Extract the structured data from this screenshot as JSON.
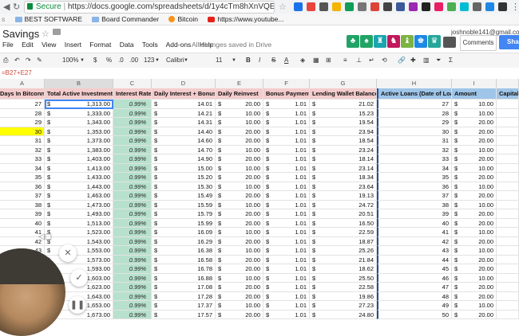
{
  "browser": {
    "secure_label": "Secure",
    "url": "https://docs.google.com/spreadsheets/d/1y4cTm8hXnVQEIO9X..."
  },
  "bookmarks": [
    "BEST SOFTWARE",
    "Board Commander",
    "Bitcoin",
    "https://www.youtube..."
  ],
  "doc": {
    "title": "Savings",
    "menus": [
      "File",
      "Edit",
      "View",
      "Insert",
      "Format",
      "Data",
      "Tools",
      "Add-ons",
      "Help"
    ],
    "save_status": "All changes saved in Drive",
    "user_email": "joshnoble141@gmail.co",
    "comments_label": "Comments",
    "share_label": "Sha"
  },
  "toolbar": {
    "zoom": "100%",
    "currency": "$",
    "percent": "%",
    "decimals_dec": ".0",
    "decimals_inc": ".00",
    "format_more": "123",
    "font": "Calibri",
    "font_size": "11",
    "bold": "B",
    "italic": "I",
    "strike": "S",
    "text_color": "A"
  },
  "formula": "=B27+E27",
  "columns": [
    "A",
    "B",
    "C",
    "D",
    "E",
    "F",
    "G",
    "H",
    "I"
  ],
  "headers": [
    "Days In Bitconnect",
    "Total Active Investment",
    "Interest Rate",
    "Daily Interest + Bonus",
    "Daily Reinvest",
    "Bonus Payment",
    "Lending Wallet Balance",
    "Active Loans (Date of Loan",
    "Amount",
    "Capital R"
  ],
  "rows": [
    {
      "day": "27",
      "investment": "1,313.00",
      "rate": "0.99%",
      "interest": "14.01",
      "reinvest": "20.00",
      "bonus": "1.01",
      "balance": "21.02",
      "loan": "27",
      "amount": "10.00"
    },
    {
      "day": "28",
      "investment": "1,333.00",
      "rate": "0.99%",
      "interest": "14.21",
      "reinvest": "10.00",
      "bonus": "1.01",
      "balance": "15.23",
      "loan": "28",
      "amount": "10.00"
    },
    {
      "day": "29",
      "investment": "1,343.00",
      "rate": "0.99%",
      "interest": "14.31",
      "reinvest": "10.00",
      "bonus": "1.01",
      "balance": "19.54",
      "loan": "29",
      "amount": "20.00"
    },
    {
      "day": "30",
      "investment": "1,353.00",
      "rate": "0.99%",
      "interest": "14.40",
      "reinvest": "20.00",
      "bonus": "1.01",
      "balance": "23.94",
      "loan": "30",
      "amount": "20.00"
    },
    {
      "day": "31",
      "investment": "1,373.00",
      "rate": "0.99%",
      "interest": "14.60",
      "reinvest": "20.00",
      "bonus": "1.01",
      "balance": "18.54",
      "loan": "31",
      "amount": "20.00"
    },
    {
      "day": "32",
      "investment": "1,383.00",
      "rate": "0.99%",
      "interest": "14.70",
      "reinvest": "10.00",
      "bonus": "1.01",
      "balance": "23.24",
      "loan": "32",
      "amount": "10.00"
    },
    {
      "day": "33",
      "investment": "1,403.00",
      "rate": "0.99%",
      "interest": "14.90",
      "reinvest": "20.00",
      "bonus": "1.01",
      "balance": "18.14",
      "loan": "33",
      "amount": "20.00"
    },
    {
      "day": "34",
      "investment": "1,413.00",
      "rate": "0.99%",
      "interest": "15.00",
      "reinvest": "10.00",
      "bonus": "1.01",
      "balance": "23.14",
      "loan": "34",
      "amount": "10.00"
    },
    {
      "day": "35",
      "investment": "1,433.00",
      "rate": "0.99%",
      "interest": "15.20",
      "reinvest": "20.00",
      "bonus": "1.01",
      "balance": "18.34",
      "loan": "35",
      "amount": "20.00"
    },
    {
      "day": "36",
      "investment": "1,443.00",
      "rate": "0.99%",
      "interest": "15.30",
      "reinvest": "10.00",
      "bonus": "1.01",
      "balance": "23.64",
      "loan": "36",
      "amount": "10.00"
    },
    {
      "day": "37",
      "investment": "1,463.00",
      "rate": "0.99%",
      "interest": "15.49",
      "reinvest": "20.00",
      "bonus": "1.01",
      "balance": "19.13",
      "loan": "37",
      "amount": "20.00"
    },
    {
      "day": "38",
      "investment": "1,473.00",
      "rate": "0.99%",
      "interest": "15.59",
      "reinvest": "10.00",
      "bonus": "1.01",
      "balance": "24.72",
      "loan": "38",
      "amount": "10.00"
    },
    {
      "day": "39",
      "investment": "1,493.00",
      "rate": "0.99%",
      "interest": "15.79",
      "reinvest": "20.00",
      "bonus": "1.01",
      "balance": "20.51",
      "loan": "39",
      "amount": "20.00"
    },
    {
      "day": "40",
      "investment": "1,513.00",
      "rate": "0.99%",
      "interest": "15.99",
      "reinvest": "20.00",
      "bonus": "1.01",
      "balance": "16.50",
      "loan": "40",
      "amount": "20.00"
    },
    {
      "day": "41",
      "investment": "1,523.00",
      "rate": "0.99%",
      "interest": "16.09",
      "reinvest": "10.00",
      "bonus": "1.01",
      "balance": "22.59",
      "loan": "41",
      "amount": "10.00"
    },
    {
      "day": "42",
      "investment": "1,543.00",
      "rate": "0.99%",
      "interest": "16.29",
      "reinvest": "20.00",
      "bonus": "1.01",
      "balance": "18.87",
      "loan": "42",
      "amount": "20.00"
    },
    {
      "day": "43",
      "investment": "1,553.00",
      "rate": "0.99%",
      "interest": "16.38",
      "reinvest": "10.00",
      "bonus": "1.01",
      "balance": "25.26",
      "loan": "43",
      "amount": "10.00"
    },
    {
      "day": "44",
      "investment": "1,573.00",
      "rate": "0.99%",
      "interest": "16.58",
      "reinvest": "20.00",
      "bonus": "1.01",
      "balance": "21.84",
      "loan": "44",
      "amount": "20.00"
    },
    {
      "day": "45",
      "investment": "1,593.00",
      "rate": "0.99%",
      "interest": "16.78",
      "reinvest": "20.00",
      "bonus": "1.01",
      "balance": "18.62",
      "loan": "45",
      "amount": "20.00"
    },
    {
      "day": "46",
      "investment": "1,603.00",
      "rate": "0.99%",
      "interest": "16.88",
      "reinvest": "10.00",
      "bonus": "1.01",
      "balance": "25.50",
      "loan": "46",
      "amount": "10.00"
    },
    {
      "day": "47",
      "investment": "1,623.00",
      "rate": "0.99%",
      "interest": "17.08",
      "reinvest": "20.00",
      "bonus": "1.01",
      "balance": "22.58",
      "loan": "47",
      "amount": "20.00"
    },
    {
      "day": "48",
      "investment": "1,643.00",
      "rate": "0.99%",
      "interest": "17.28",
      "reinvest": "20.00",
      "bonus": "1.01",
      "balance": "19.86",
      "loan": "48",
      "amount": "20.00"
    },
    {
      "day": "49",
      "investment": "1,653.00",
      "rate": "0.99%",
      "interest": "17.37",
      "reinvest": "10.00",
      "bonus": "1.01",
      "balance": "27.23",
      "loan": "49",
      "amount": "10.00"
    },
    {
      "day": "50",
      "investment": "1,673.00",
      "rate": "0.99%",
      "interest": "17.57",
      "reinvest": "20.00",
      "bonus": "1.01",
      "balance": "24.80",
      "loan": "50",
      "amount": "20.00"
    }
  ],
  "currency_symbol": "$",
  "colors": {
    "header_fill": "#f4cccc",
    "loan_header_fill": "#9fc5e8",
    "rate_fill": "#b7e1cd",
    "highlight": "#ffff00",
    "selection": "#4285f4"
  }
}
